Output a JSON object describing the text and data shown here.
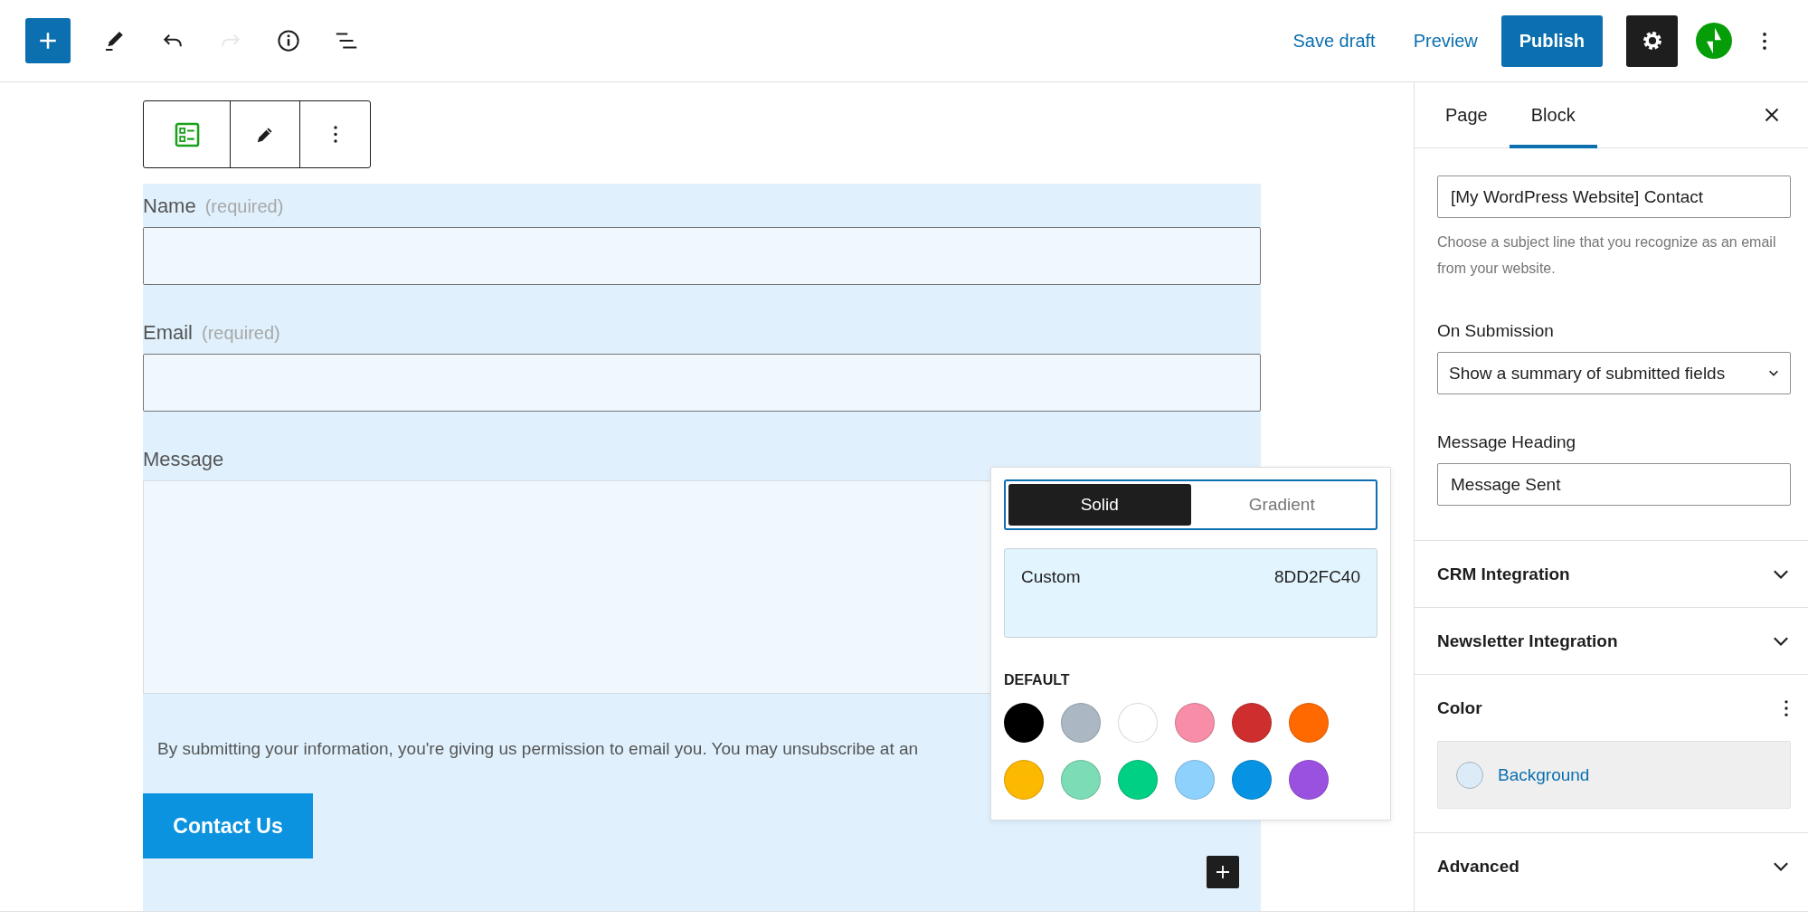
{
  "header": {
    "tools": [
      {
        "kind": "add",
        "disabled": false
      },
      {
        "kind": "edit",
        "disabled": false
      },
      {
        "kind": "undo",
        "disabled": false
      },
      {
        "kind": "redo",
        "disabled": true
      },
      {
        "kind": "info",
        "disabled": false
      },
      {
        "kind": "outline",
        "disabled": false
      }
    ],
    "save_draft": "Save draft",
    "preview": "Preview",
    "publish": "Publish",
    "settings": {
      "pressed": true
    }
  },
  "block_toolbar": {
    "tools": [
      {
        "kind": "form"
      },
      {
        "kind": "edit"
      },
      {
        "kind": "more"
      }
    ]
  },
  "form": {
    "fields": [
      {
        "kind": "input",
        "label": "Name",
        "hint": "(required)"
      },
      {
        "kind": "input",
        "label": "Email",
        "hint": "(required)"
      },
      {
        "kind": "textarea",
        "label": "Message"
      }
    ],
    "consent": "By submitting your information, you're giving us permission to email you. You may unsubscribe at an",
    "submit": "Contact Us"
  },
  "color_picker": {
    "modes": [
      {
        "label": "Solid",
        "selected": true
      },
      {
        "label": "Gradient",
        "selected": false
      }
    ],
    "custom": {
      "label": "Custom",
      "value": "8DD2FC40"
    },
    "default_label": "DEFAULT",
    "swatches": [
      {
        "color": "#000000"
      },
      {
        "color": "#abb8c3"
      },
      {
        "color": "#ffffff"
      },
      {
        "color": "#f78da7"
      },
      {
        "color": "#cf2e2e"
      },
      {
        "color": "#ff6900"
      },
      {
        "color": "#fcb900"
      },
      {
        "color": "#7bdcb5"
      },
      {
        "color": "#00d084"
      },
      {
        "color": "#8ed1fc"
      },
      {
        "color": "#0693e3"
      },
      {
        "color": "#9b51e0"
      }
    ]
  },
  "sidebar": {
    "tabs": [
      {
        "label": "Page",
        "selected": false
      },
      {
        "label": "Block",
        "selected": true
      }
    ],
    "subject": {
      "value": "[My WordPress Website] Contact",
      "help": "Choose a subject line that you recognize as an email from your website."
    },
    "on_submission": {
      "label": "On Submission",
      "value": "Show a summary of submitted fields"
    },
    "message_heading": {
      "label": "Message Heading",
      "value": "Message Sent"
    },
    "panels": [
      {
        "title": "CRM Integration",
        "expanded": false
      },
      {
        "title": "Newsletter Integration",
        "expanded": false
      },
      {
        "title": "Color",
        "expanded": true,
        "items": [
          {
            "label": "Background",
            "color": "#dbecf8"
          }
        ]
      },
      {
        "title": "Advanced",
        "expanded": false
      }
    ]
  }
}
